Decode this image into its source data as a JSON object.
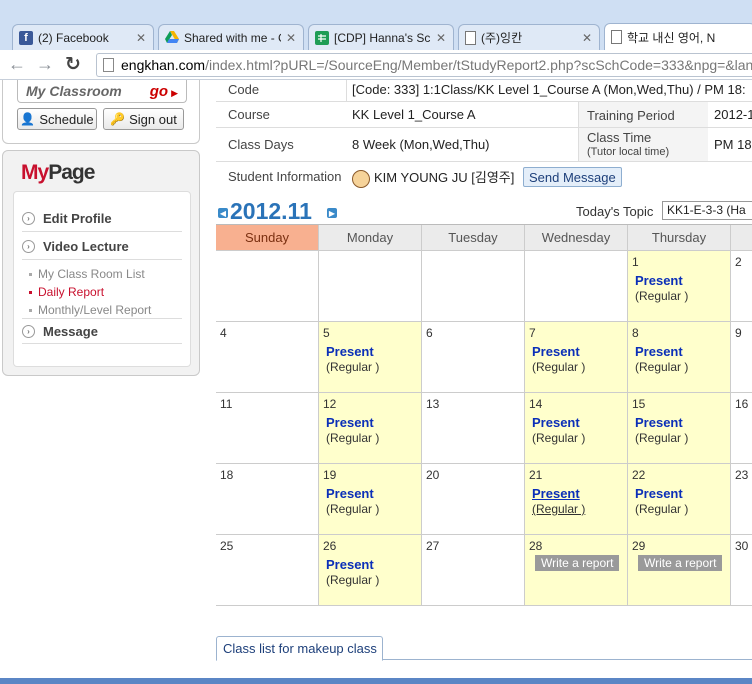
{
  "browser": {
    "tabs": [
      {
        "title": "(2) Facebook",
        "favicon": "facebook-icon"
      },
      {
        "title": "Shared with me - Go",
        "favicon": "google-drive-icon"
      },
      {
        "title": "[CDP] Hanna's Schec",
        "favicon": "spreadsheet-icon"
      },
      {
        "title": "(주)잉칸",
        "favicon": "page-icon"
      },
      {
        "title": "학교 내신 영어, N",
        "favicon": "page-icon"
      }
    ],
    "url_host": "engkhan.com",
    "url_path": "/index.html?pURL=/SourceEng/Member/tStudyReport2.php?scSchCode=333&npg=&lan"
  },
  "sidebar": {
    "classroom_label": "My Classroom",
    "classroom_go": "go",
    "schedule_label": "Schedule",
    "signout_label": "Sign out",
    "mypage_title_my": "My",
    "mypage_title_page": "Page",
    "menu": {
      "edit_profile": "Edit Profile",
      "video_lecture": "Video Lecture",
      "class_room_list": "My Class Room List",
      "daily_report": "Daily Report",
      "monthly_report": "Monthly/Level Report",
      "message": "Message"
    }
  },
  "info": {
    "code_label": "Code",
    "code_value": "[Code: 333] 1:1Class/KK Level 1_Course A (Mon,Wed,Thu) / PM 18:",
    "course_label": "Course",
    "course_value": "KK Level 1_Course A",
    "training_period_label": "Training Period",
    "training_period_value": "2012-1",
    "class_days_label": "Class Days",
    "class_days_value": "8 Week (Mon,Wed,Thu)",
    "class_time_label": "Class Time",
    "class_time_sub": "(Tutor local time)",
    "class_time_value": "PM 18",
    "student_label": "Student Information",
    "student_value": "KIM YOUNG JU [김영주]",
    "send_message": "Send Message"
  },
  "calendar": {
    "month": "2012.11",
    "topic_label": "Today's Topic",
    "topic_value": "KK1-E-3-3 (Ha",
    "days": [
      "Sunday",
      "Monday",
      "Tuesday",
      "Wednesday",
      "Thursday",
      ""
    ],
    "present": "Present",
    "regular": "(Regular )",
    "write_report": "Write a report",
    "weeks": [
      [
        {
          "d": ""
        },
        {
          "d": ""
        },
        {
          "d": ""
        },
        {
          "d": ""
        },
        {
          "d": "1",
          "s": "p"
        },
        {
          "d": "2"
        }
      ],
      [
        {
          "d": "4"
        },
        {
          "d": "5",
          "s": "p"
        },
        {
          "d": "6"
        },
        {
          "d": "7",
          "s": "p"
        },
        {
          "d": "8",
          "s": "p"
        },
        {
          "d": "9"
        }
      ],
      [
        {
          "d": "11"
        },
        {
          "d": "12",
          "s": "p"
        },
        {
          "d": "13"
        },
        {
          "d": "14",
          "s": "p"
        },
        {
          "d": "15",
          "s": "p"
        },
        {
          "d": "16"
        }
      ],
      [
        {
          "d": "18"
        },
        {
          "d": "19",
          "s": "p"
        },
        {
          "d": "20"
        },
        {
          "d": "21",
          "s": "pl"
        },
        {
          "d": "22",
          "s": "p"
        },
        {
          "d": "23"
        }
      ],
      [
        {
          "d": "25"
        },
        {
          "d": "26",
          "s": "p"
        },
        {
          "d": "27"
        },
        {
          "d": "28",
          "s": "w"
        },
        {
          "d": "29",
          "s": "w"
        },
        {
          "d": "30"
        }
      ]
    ]
  },
  "makeup": {
    "tab_label": "Class list for makeup class"
  },
  "colors": {
    "accent_blue": "#2a73b8",
    "present_blue": "#0b2fb8",
    "attended_yellow": "#ffffcc",
    "sunday_header": "#f8b090",
    "brand_red": "#c8102e"
  }
}
